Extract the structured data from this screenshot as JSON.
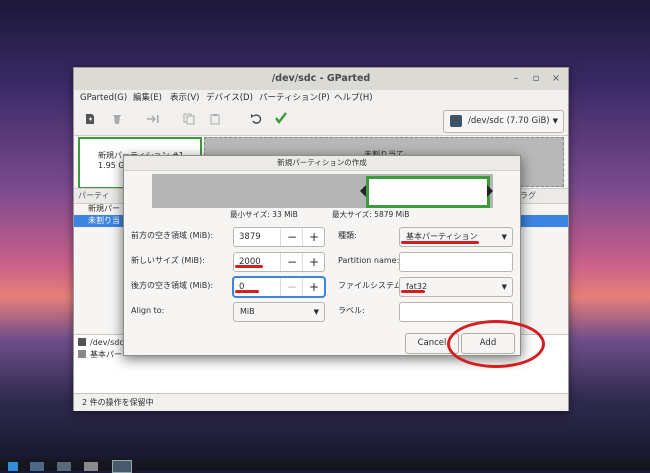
{
  "window": {
    "title": "/dev/sdc - GParted",
    "minimize": "–",
    "maximize": "▫",
    "close": "×"
  },
  "menubar": [
    "GParted(G)",
    "編集(E)",
    "表示(V)",
    "デバイス(D)",
    "パーティション(P)",
    "ヘルプ(H)"
  ],
  "toolbar": {
    "icons": [
      "new-partition-icon",
      "delete-icon",
      "resize-move-icon",
      "copy-icon",
      "paste-icon",
      "undo-icon",
      "apply-icon"
    ],
    "device": "/dev/sdc (7.70 GiB)"
  },
  "graph": {
    "new_partition": "新規パーティション #1",
    "new_partition_size": "1.95 G",
    "unallocated": "未割り当て"
  },
  "list": {
    "header_partition": "パーティ",
    "header_flags": "フラグ",
    "rows": [
      "新規パー",
      "未割り当"
    ]
  },
  "operations": {
    "items": [
      "/dev/sdc",
      "基本パー"
    ]
  },
  "status": "2 件の操作を保留中",
  "dialog": {
    "title": "新規パーティションの作成",
    "min_size": "最小サイズ: 33 MiB",
    "max_size": "最大サイズ: 5879 MiB",
    "free_before_label": "前方の空き領域 (MiB):",
    "free_before": "3879",
    "new_size_label": "新しいサイズ (MiB):",
    "new_size": "2000",
    "free_after_label": "後方の空き領域 (MiB):",
    "free_after": "0",
    "align_label": "Align to:",
    "align": "MiB",
    "type_label": "種類:",
    "type": "基本パーティション",
    "name_label": "Partition name:",
    "fs_label": "ファイルシステム:",
    "fs": "fat32",
    "label_label": "ラベル:",
    "cancel": "Cancel",
    "add": "Add"
  },
  "colors": {
    "selection": "#3d84e0",
    "partition_border": "#3c9c3c",
    "annotation_red": "#d21f1f"
  }
}
